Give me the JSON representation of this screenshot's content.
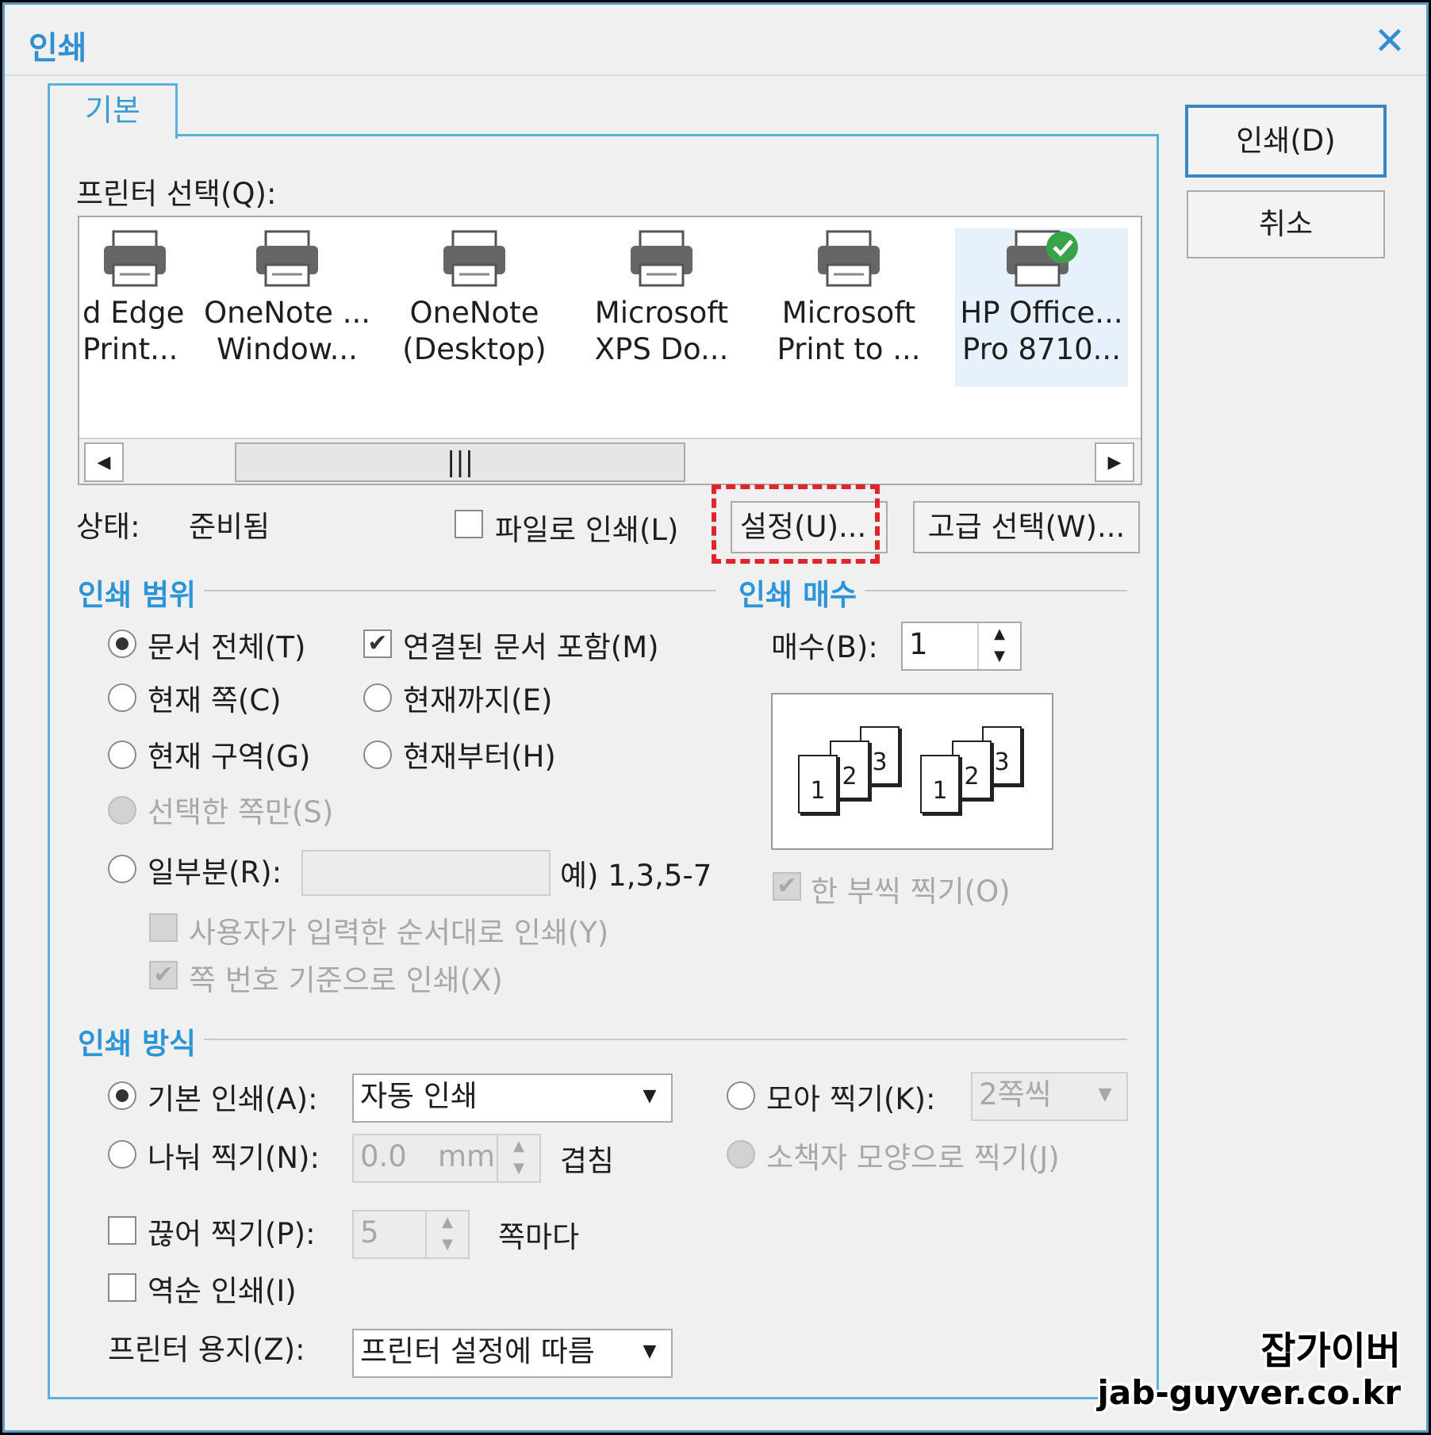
{
  "dialog": {
    "title": "인쇄",
    "close_label": "✕"
  },
  "tabs": {
    "basic": "기본"
  },
  "printer": {
    "select_label": "프린터 선택(Q):",
    "items": [
      {
        "name": "d Edge\nPrint..."
      },
      {
        "name": "OneNote ...\nWindow..."
      },
      {
        "name": "OneNote\n(Desktop)"
      },
      {
        "name": "Microsoft\nXPS Do..."
      },
      {
        "name": "Microsoft\nPrint to ..."
      },
      {
        "name": "HP Office...\nPro 8710..."
      }
    ],
    "status_label": "상태:",
    "status_value": "준비됨",
    "print_to_file": "파일로 인쇄(L)",
    "settings_button": "설정(U)...",
    "advanced_button": "고급 선택(W)..."
  },
  "buttons": {
    "print": "인쇄(D)",
    "cancel": "취소"
  },
  "range": {
    "section": "인쇄 범위",
    "all": "문서 전체(T)",
    "include_linked": "연결된 문서 포함(M)",
    "current_page": "현재 쪽(C)",
    "up_to_current": "현재까지(E)",
    "current_section": "현재 구역(G)",
    "from_current": "현재부터(H)",
    "selection_only": "선택한 쪽만(S)",
    "partial": "일부분(R):",
    "partial_example": "예) 1,3,5-7",
    "user_order": "사용자가 입력한 순서대로 인쇄(Y)",
    "by_page_number": "쪽 번호 기준으로 인쇄(X)"
  },
  "copies": {
    "section": "인쇄 매수",
    "label": "매수(B):",
    "value": "1",
    "collate": "한 부씩 찍기(O)",
    "pages": [
      "1",
      "2",
      "3"
    ]
  },
  "method": {
    "section": "인쇄 방식",
    "basic_print": "기본 인쇄(A):",
    "basic_print_value": "자동 인쇄",
    "gather": "모아 찍기(K):",
    "gather_value": "2쪽씩",
    "split": "나눠 찍기(N):",
    "split_value": "0.0",
    "split_unit": "mm",
    "overlap": "겹침",
    "booklet": "소책자 모양으로 찍기(J)",
    "cut": "끊어 찍기(P):",
    "cut_value": "5",
    "per_page": "쪽마다",
    "reverse": "역순 인쇄(I)",
    "paper_label": "프린터 용지(Z):",
    "paper_value": "프린터 설정에 따름"
  },
  "watermark": {
    "line1": "잡가이버",
    "line2": "jab-guyver.co.kr"
  }
}
